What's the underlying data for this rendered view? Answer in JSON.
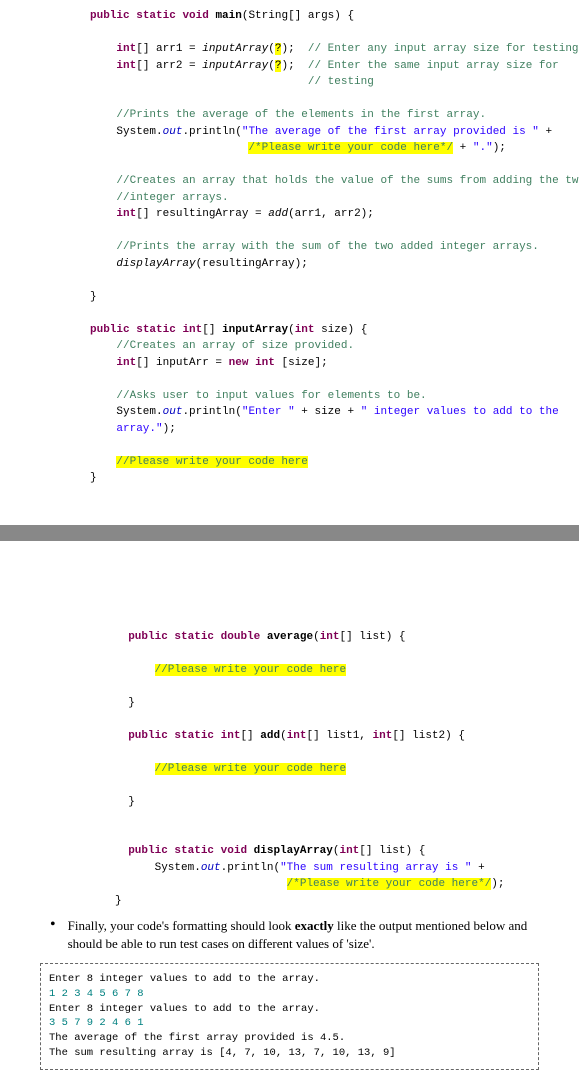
{
  "code1": {
    "l1a": "public",
    "l1b": "static",
    "l1c": "void",
    "l1d": "main",
    "l1e": "(String[] args) {",
    "l2a": "int",
    "l2b": "[] arr1 = ",
    "l2c": "inputArray",
    "l2d": "(",
    "l2e": "?",
    "l2f": ");  ",
    "l2g": "// Enter any input array size for testing",
    "l3a": "int",
    "l3b": "[] arr2 = ",
    "l3c": "inputArray",
    "l3d": "(",
    "l3e": "?",
    "l3f": ");  ",
    "l3g": "// Enter the same input array size for",
    "l3h": "// testing",
    "l4": "//Prints the average of the elements in the first array.",
    "l5a": "System.",
    "l5b": "out",
    "l5c": ".println(",
    "l5d": "\"The average of the first array provided is \"",
    "l5e": " +",
    "l6a": "/*Please write your code here*/",
    "l6b": " + ",
    "l6c": "\".\"",
    "l6d": ");",
    "l7": "//Creates an array that holds the value of the sums from adding the two",
    "l7b": "//integer arrays.",
    "l8a": "int",
    "l8b": "[] resultingArray = ",
    "l8c": "add",
    "l8d": "(arr1, arr2);",
    "l9": "//Prints the array with the sum of the two added integer arrays.",
    "l10a": "displayArray",
    "l10b": "(resultingArray);",
    "l11": "}",
    "l12a": "public",
    "l12b": "static",
    "l12c": "int",
    "l12d": "[] ",
    "l12e": "inputArray",
    "l12f": "(",
    "l12g": "int",
    "l12h": " size) {",
    "l13": "//Creates an array of size provided.",
    "l14a": "int",
    "l14b": "[] inputArr = ",
    "l14c": "new",
    "l14d": " ",
    "l14e": "int",
    "l14f": " [size];",
    "l15": "//Asks user to input values for elements to be.",
    "l16a": "System.",
    "l16b": "out",
    "l16c": ".println(",
    "l16d": "\"Enter \"",
    "l16e": " + size + ",
    "l16f": "\" integer values to add to the",
    "l16g": "array.\"",
    "l16h": ");",
    "l17": "//Please write your code here",
    "l18": "}"
  },
  "code2": {
    "l1a": "public",
    "l1b": "static",
    "l1c": "double",
    "l1d": "average",
    "l1e": "(",
    "l1f": "int",
    "l1g": "[] list) {",
    "l2": "//Please write your code here",
    "l3": "}",
    "l4a": "public",
    "l4b": "static",
    "l4c": "int",
    "l4d": "[] ",
    "l4e": "add",
    "l4f": "(",
    "l4g": "int",
    "l4h": "[] list1, ",
    "l4i": "int",
    "l4j": "[] list2) {",
    "l5": "//Please write your code here",
    "l6": "}",
    "l7a": "public",
    "l7b": "static",
    "l7c": "void",
    "l7d": "displayArray",
    "l7e": "(",
    "l7f": "int",
    "l7g": "[] list) {",
    "l8a": "System.",
    "l8b": "out",
    "l8c": ".println(",
    "l8d": "\"The sum resulting array is \"",
    "l8e": " +",
    "l9a": "/*Please write your code here*/",
    "l9b": ");",
    "l10": "}"
  },
  "bullet": {
    "text_a": "Finally, your code's formatting should look ",
    "text_b": "exactly",
    "text_c": " like the output mentioned below and should be able to run test cases on different values of 'size'."
  },
  "output": {
    "l1": "Enter 8 integer values to add to the array.",
    "l2": "1 2 3 4 5 6 7 8",
    "l3": "Enter 8 integer values to add to the array.",
    "l4": "3 5 7 9 2 4 6 1",
    "l5": "The average of the first array provided is 4.5.",
    "l6": "The sum resulting array is [4, 7, 10, 13, 7, 10, 13, 9]"
  }
}
